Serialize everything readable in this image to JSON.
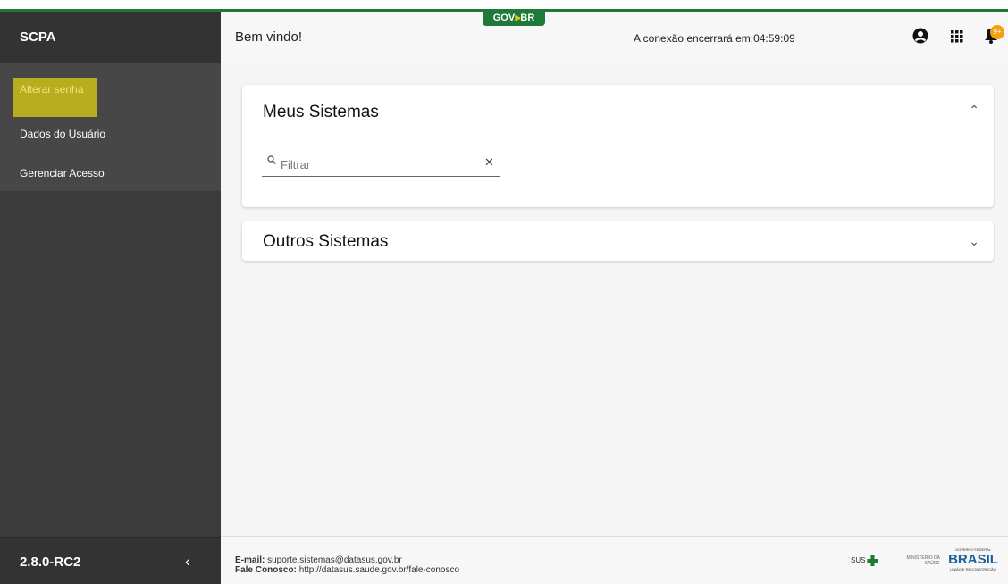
{
  "sidebar": {
    "title": "SCPA",
    "items": [
      {
        "label": "Alterar senha"
      },
      {
        "label": "Dados do Usuário"
      },
      {
        "label": "Gerenciar Acesso"
      }
    ],
    "version": "2.8.0-RC2",
    "collapse_icon": "chevron-left-icon"
  },
  "header": {
    "welcome": "Bem vindo!",
    "govbr_logo": "GOV.BR",
    "session_timer": "A conexão encerrará em:04:59:09",
    "icons": [
      "user-icon",
      "apps-grid-icon",
      "bell-icon"
    ],
    "notification_badge": "9+"
  },
  "main": {
    "cards": [
      {
        "title": "Meus Sistemas",
        "expanded": true,
        "chevron": "chevron-up-icon"
      },
      {
        "title": "Outros Sistemas",
        "expanded": false,
        "chevron": "chevron-down-icon"
      }
    ],
    "filter": {
      "placeholder": "Filtrar",
      "value": ""
    }
  },
  "footer": {
    "email_label": "E-mail:",
    "email_value": "suporte.sistemas@datasus.gov.br",
    "contact_label": "Fale Conosco:",
    "contact_value": "http://datasus.saude.gov.br/fale-conosco",
    "logos": {
      "sus": "SUS",
      "ministerio": "MINISTÉRIO DA SAÚDE",
      "brasil_top": "GOVERNO FEDERAL",
      "brasil": "BRASIL",
      "brasil_bottom": "UNIÃO E RECONSTRUÇÃO"
    }
  },
  "colors": {
    "accent_green": "#1f7a3a",
    "sidebar_bg": "#3b3b3b",
    "highlight": "#b7ad1f",
    "badge": "#f2a20b"
  }
}
